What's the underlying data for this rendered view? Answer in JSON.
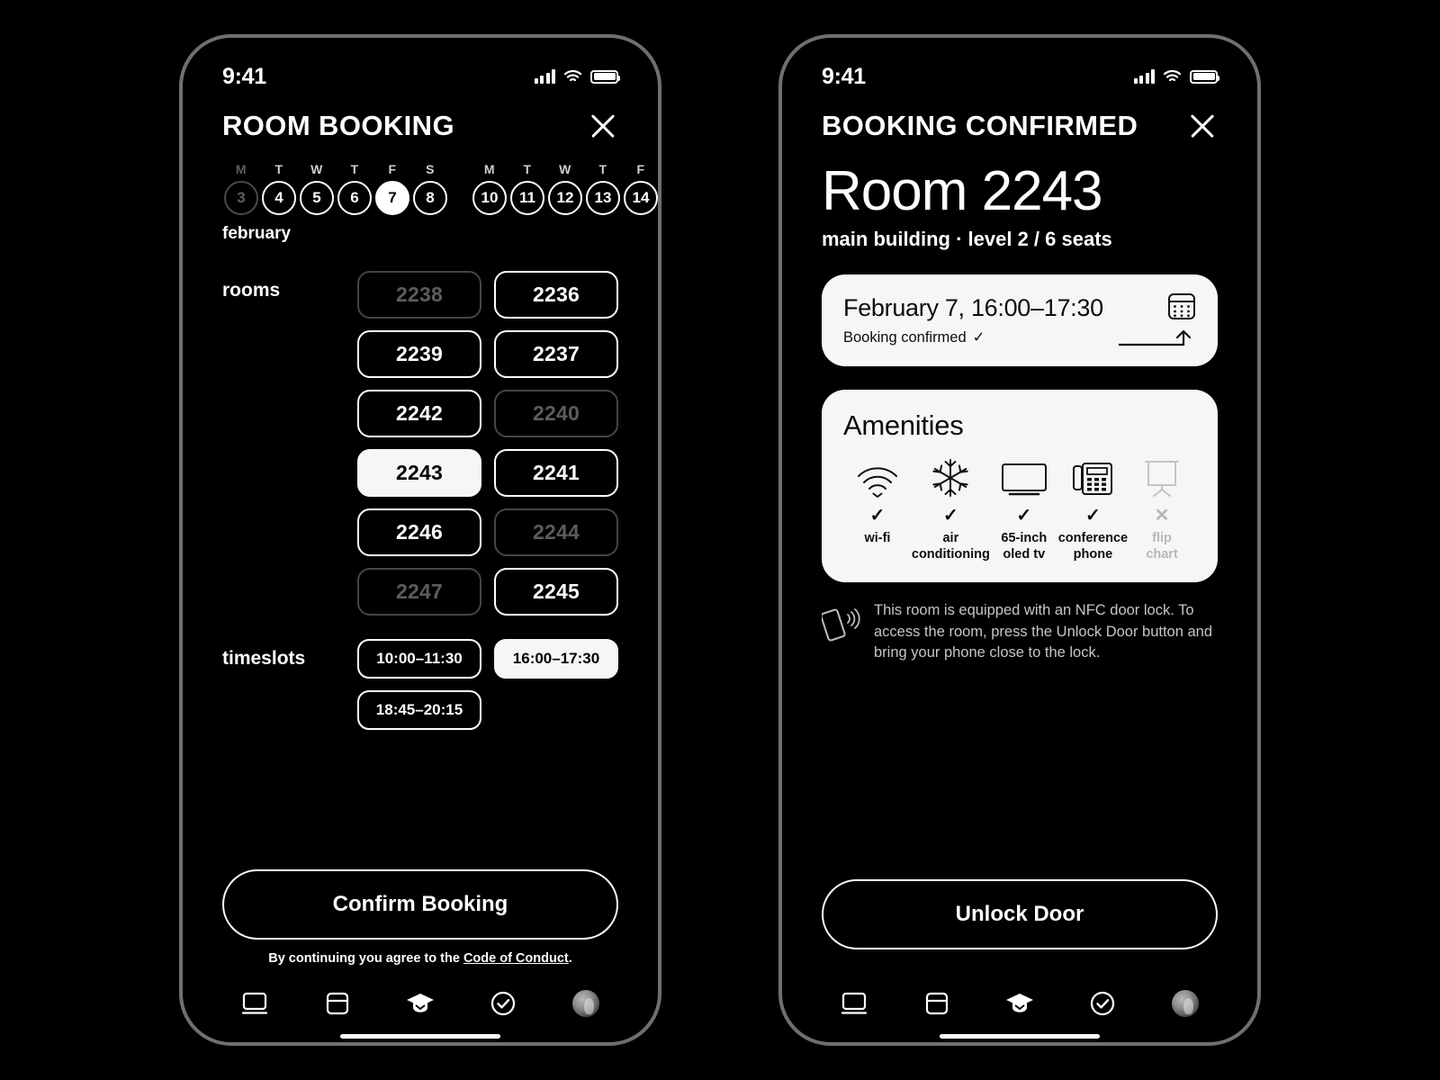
{
  "theme": {
    "background": "#000000",
    "foreground": "#ffffff",
    "card": "#f6f6f4",
    "dim": "#5c5c5c",
    "frame": "#6f6f6f"
  },
  "booking_screen": {
    "status_bar": {
      "time": "9:41",
      "signal_icon": "cellular-bars-icon",
      "wifi_icon": "wifi-icon",
      "battery_icon": "battery-full-icon"
    },
    "header": {
      "title": "ROOM BOOKING",
      "close_label": "close-icon"
    },
    "calendar": {
      "month": "february",
      "days": [
        {
          "dow": "M",
          "num": "3",
          "state": "disabled"
        },
        {
          "dow": "T",
          "num": "4",
          "state": "available"
        },
        {
          "dow": "W",
          "num": "5",
          "state": "available"
        },
        {
          "dow": "T",
          "num": "6",
          "state": "available"
        },
        {
          "dow": "F",
          "num": "7",
          "state": "selected"
        },
        {
          "dow": "S",
          "num": "8",
          "state": "available"
        },
        {
          "dow": "M",
          "num": "10",
          "state": "available",
          "week_gap": true
        },
        {
          "dow": "T",
          "num": "11",
          "state": "available"
        },
        {
          "dow": "W",
          "num": "12",
          "state": "available"
        },
        {
          "dow": "T",
          "num": "13",
          "state": "available"
        },
        {
          "dow": "F",
          "num": "14",
          "state": "available"
        }
      ]
    },
    "rooms": {
      "label": "rooms",
      "column_left": [
        {
          "number": "2238",
          "state": "unavailable"
        },
        {
          "number": "2239",
          "state": "available"
        },
        {
          "number": "2242",
          "state": "available"
        },
        {
          "number": "2243",
          "state": "selected"
        },
        {
          "number": "2246",
          "state": "available"
        },
        {
          "number": "2247",
          "state": "unavailable"
        }
      ],
      "column_right": [
        {
          "number": "2236",
          "state": "available"
        },
        {
          "number": "2237",
          "state": "available"
        },
        {
          "number": "2240",
          "state": "unavailable"
        },
        {
          "number": "2241",
          "state": "available"
        },
        {
          "number": "2244",
          "state": "unavailable"
        },
        {
          "number": "2245",
          "state": "available"
        }
      ]
    },
    "timeslots": {
      "label": "timeslots",
      "options": [
        {
          "range": "10:00–11:30",
          "state": "available"
        },
        {
          "range": "16:00–17:30",
          "state": "selected"
        },
        {
          "range": "18:45–20:15",
          "state": "available"
        }
      ]
    },
    "cta": {
      "label": "Confirm Booking"
    },
    "legal": {
      "prefix": "By continuing you agree to the ",
      "link": "Code of Conduct",
      "suffix": "."
    },
    "nav": [
      {
        "icon": "monitor-icon",
        "active": false
      },
      {
        "icon": "window-panel-icon",
        "active": false
      },
      {
        "icon": "graduation-cap-icon",
        "active": true
      },
      {
        "icon": "check-circle-icon",
        "active": false
      },
      {
        "icon": "avatar",
        "active": false
      }
    ]
  },
  "confirmed_screen": {
    "status_bar": {
      "time": "9:41",
      "signal_icon": "cellular-bars-icon",
      "wifi_icon": "wifi-icon",
      "battery_icon": "battery-full-icon"
    },
    "header": {
      "title": "BOOKING CONFIRMED",
      "close_label": "close-icon"
    },
    "room": {
      "title": "Room 2243",
      "subtitle": "main building · level 2 / 6 seats"
    },
    "booking_card": {
      "date_time": "February 7, 16:00–17:30",
      "status": "Booking confirmed",
      "status_check": "✓",
      "calendar_icon": "calendar-icon",
      "export_icon": "arrow-up-export-icon"
    },
    "amenities": {
      "title": "Amenities",
      "items": [
        {
          "icon": "wifi-icon",
          "label": "wi-fi",
          "mark": "✓",
          "included": true
        },
        {
          "icon": "snowflake-icon",
          "label": "air\nconditioning",
          "mark": "✓",
          "included": true
        },
        {
          "icon": "television-icon",
          "label": "65-inch\noled tv",
          "mark": "✓",
          "included": true
        },
        {
          "icon": "conference-phone-icon",
          "label": "conference\nphone",
          "mark": "✓",
          "included": true
        },
        {
          "icon": "flip-chart-icon",
          "label": "flip\nchart",
          "mark": "✕",
          "included": false
        }
      ]
    },
    "nfc_note": {
      "icon": "nfc-phone-tap-icon",
      "text": "This room is equipped with an NFC door lock. To access the room, press the Unlock Door button and bring your phone close to the lock."
    },
    "cta": {
      "label": "Unlock Door"
    },
    "nav": [
      {
        "icon": "monitor-icon",
        "active": false
      },
      {
        "icon": "window-panel-icon",
        "active": false
      },
      {
        "icon": "graduation-cap-icon",
        "active": true
      },
      {
        "icon": "check-circle-icon",
        "active": false
      },
      {
        "icon": "avatar",
        "active": false
      }
    ]
  }
}
